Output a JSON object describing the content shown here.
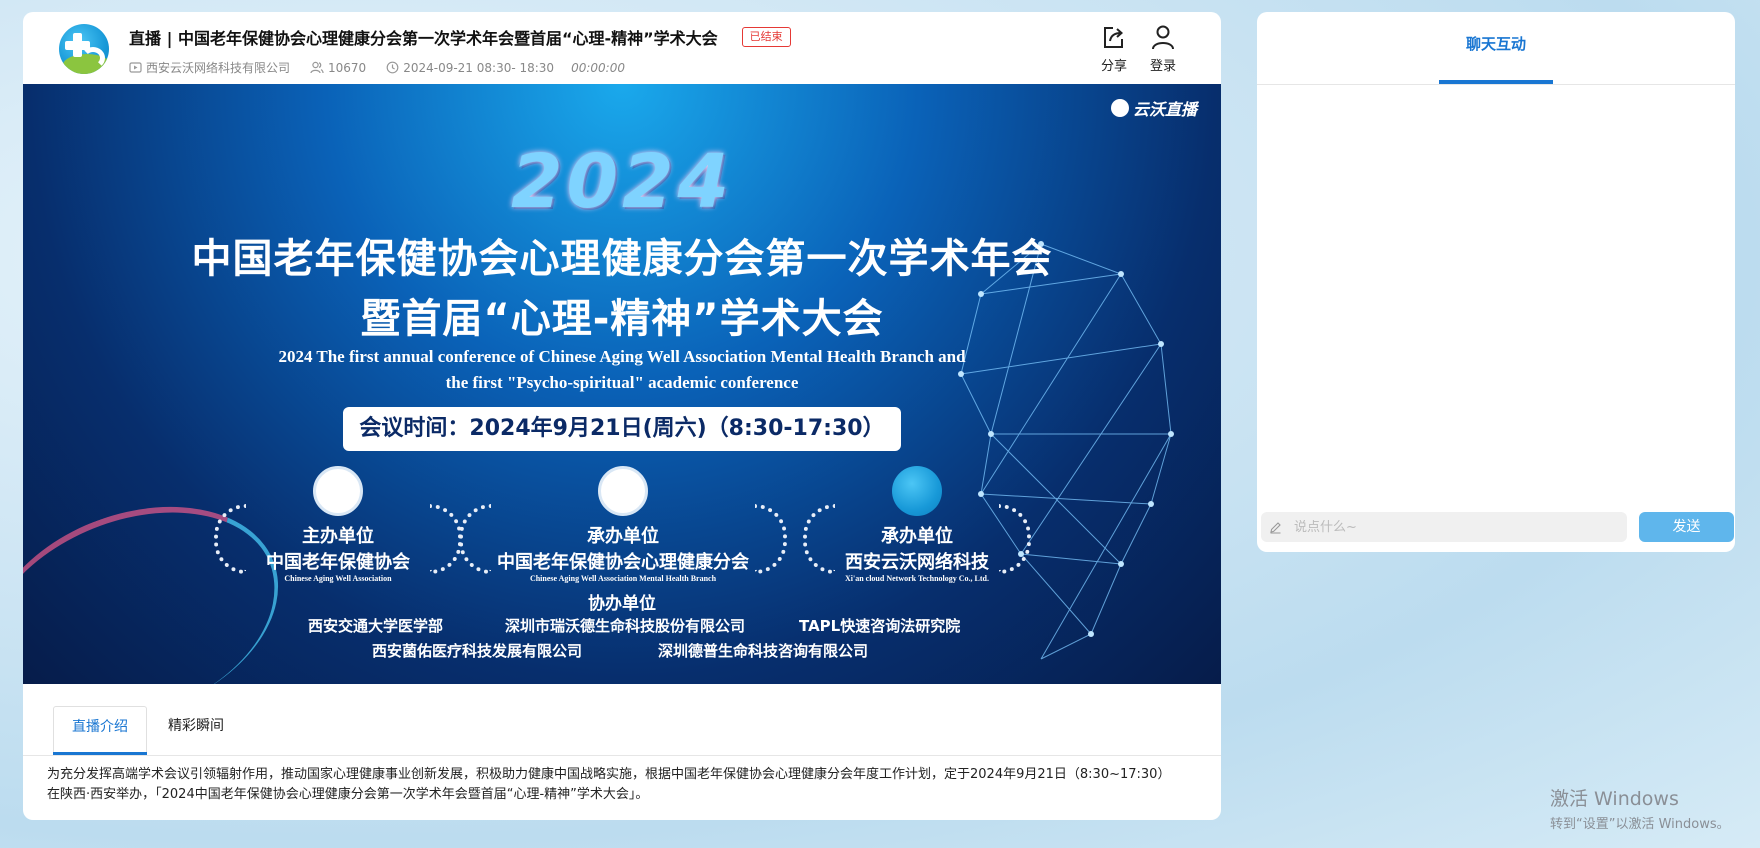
{
  "header": {
    "title": "直播 | 中国老年保健协会心理健康分会第一次学术年会暨首届“心理-精神”学术大会",
    "status_badge": "已结束",
    "organizer": "西安云沃网络科技有限公司",
    "viewers": "10670",
    "schedule": "2024-09-21 08:30- 18:30",
    "duration": "00:00:00",
    "share_label": "分享",
    "login_label": "登录"
  },
  "banner": {
    "brand": "云沃直播",
    "year": "2024",
    "title_line1": "中国老年保健协会心理健康分会第一次学术年会",
    "title_line2": "暨首届“心理-精神”学术大会",
    "english_line1": "2024 The first annual conference of Chinese Aging Well Association Mental Health Branch and",
    "english_line2": "the first \"Psycho-spiritual\" academic conference",
    "meeting_time": "会议时间：2024年9月21日(周六)（8:30-17:30）",
    "orgs": [
      {
        "role": "主办单位",
        "name": "中国老年保健协会",
        "en": "Chinese Aging Well Association"
      },
      {
        "role": "承办单位",
        "name": "中国老年保健协会心理健康分会",
        "en": "Chinese Aging Well Association Mental Health Branch"
      },
      {
        "role": "承办单位",
        "name": "西安云沃网络科技",
        "en": "Xi'an cloud Network Technology Co., Ltd."
      }
    ],
    "co_organizer_title": "协办单位",
    "co_organizers": [
      "西安交通大学医学部",
      "深圳市瑞沃德生命科技股份有限公司",
      "TAPL快速咨询法研究院",
      "西安菌佑医疗科技发展有限公司",
      "深圳德普生命科技咨询有限公司"
    ]
  },
  "tabs": [
    {
      "label": "直播介绍",
      "active": true
    },
    {
      "label": "精彩瞬间",
      "active": false
    }
  ],
  "description": "为充分发挥高端学术会议引领辐射作用，推动国家心理健康事业创新发展，积极助力健康中国战略实施，根据中国老年保健协会心理健康分会年度工作计划，定于2024年9月21日（8:30~17:30）在陕西·西安举办，「2024中国老年保健协会心理健康分会第一次学术年会暨首届“心理-精神”学术大会」。",
  "chat": {
    "tab_label": "聊天互动",
    "input_placeholder": "说点什么~",
    "send_label": "发送"
  },
  "watermark": {
    "line1": "激活 Windows",
    "line2": "转到“设置”以激活 Windows。"
  },
  "colors": {
    "accent": "#1976d2",
    "badge_red": "#e53935",
    "send_button": "#5fb6ec"
  }
}
